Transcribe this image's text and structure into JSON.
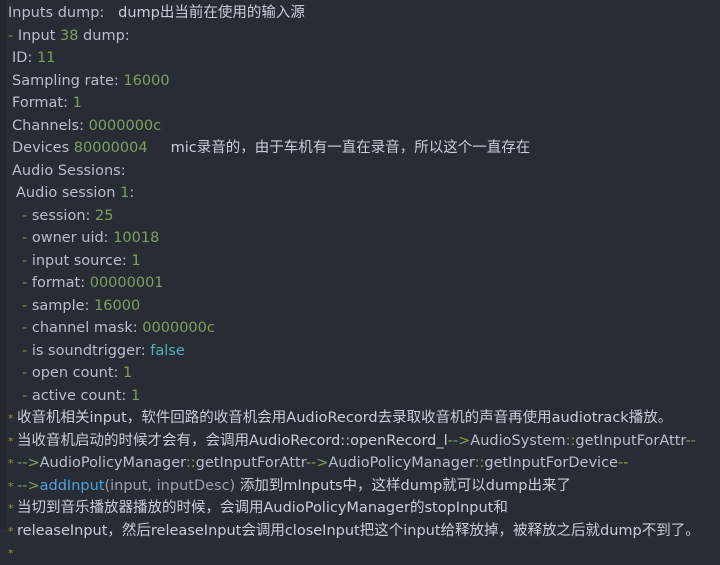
{
  "theme": {
    "background": "#282c34",
    "gutter": "#24272e",
    "text": "#b9bfca",
    "number_green": "#7f9f5f",
    "teal": "#4cb5b5",
    "blue": "#4aa3e0",
    "bullet": "#a08c4a"
  },
  "doc": {
    "title": "Inputs dump",
    "lines": [
      {
        "id": "line-inputs-dump-header",
        "indent": 0,
        "bullet": "",
        "segments": [
          {
            "text": "Inputs dump:",
            "style": "plain"
          },
          {
            "text": "   ",
            "style": "plain"
          },
          {
            "text": "dump出当前在使用的输入源",
            "style": "cjk"
          }
        ]
      },
      {
        "id": "line-input-38-dump",
        "indent": 0,
        "bullet": "",
        "segments": [
          {
            "text": "- ",
            "style": "dash"
          },
          {
            "text": "Input ",
            "style": "plain"
          },
          {
            "text": "38",
            "style": "num"
          },
          {
            "text": " dump:",
            "style": "plain"
          }
        ]
      },
      {
        "id": "line-id",
        "indent": 1,
        "bullet": "",
        "segments": [
          {
            "text": "ID: ",
            "style": "plain"
          },
          {
            "text": "11",
            "style": "num"
          }
        ]
      },
      {
        "id": "line-sampling-rate",
        "indent": 1,
        "bullet": "",
        "segments": [
          {
            "text": "Sampling rate: ",
            "style": "plain"
          },
          {
            "text": "16000",
            "style": "num"
          }
        ]
      },
      {
        "id": "line-format",
        "indent": 1,
        "bullet": "",
        "segments": [
          {
            "text": "Format: ",
            "style": "plain"
          },
          {
            "text": "1",
            "style": "num"
          }
        ]
      },
      {
        "id": "line-channels",
        "indent": 1,
        "bullet": "",
        "segments": [
          {
            "text": "Channels: ",
            "style": "plain"
          },
          {
            "text": "0000000c",
            "style": "num"
          }
        ]
      },
      {
        "id": "line-devices",
        "indent": 1,
        "bullet": "",
        "segments": [
          {
            "text": "Devices ",
            "style": "plain"
          },
          {
            "text": "80000004",
            "style": "num"
          },
          {
            "text": "     ",
            "style": "plain"
          },
          {
            "text": "mic录音的，由于车机有一直在录音，所以这个一直存在",
            "style": "cjk"
          }
        ]
      },
      {
        "id": "line-audio-sessions",
        "indent": 1,
        "bullet": "",
        "segments": [
          {
            "text": "Audio Sessions:",
            "style": "plain"
          }
        ]
      },
      {
        "id": "line-audio-session-1",
        "indent": 2,
        "bullet": "",
        "segments": [
          {
            "text": "Audio session ",
            "style": "plain"
          },
          {
            "text": "1",
            "style": "num"
          },
          {
            "text": ":",
            "style": "plain"
          }
        ]
      },
      {
        "id": "line-session",
        "indent": 3,
        "bullet": "",
        "segments": [
          {
            "text": "- ",
            "style": "dash"
          },
          {
            "text": "session: ",
            "style": "plain"
          },
          {
            "text": "25",
            "style": "num"
          }
        ]
      },
      {
        "id": "line-owner-uid",
        "indent": 3,
        "bullet": "",
        "segments": [
          {
            "text": "- ",
            "style": "dash"
          },
          {
            "text": "owner uid: ",
            "style": "plain"
          },
          {
            "text": "10018",
            "style": "num"
          }
        ]
      },
      {
        "id": "line-input-source",
        "indent": 3,
        "bullet": "",
        "segments": [
          {
            "text": "- ",
            "style": "dash"
          },
          {
            "text": "input source: ",
            "style": "plain"
          },
          {
            "text": "1",
            "style": "num"
          }
        ]
      },
      {
        "id": "line-format-session",
        "indent": 3,
        "bullet": "",
        "segments": [
          {
            "text": "- ",
            "style": "dash"
          },
          {
            "text": "format: ",
            "style": "plain"
          },
          {
            "text": "00000001",
            "style": "num"
          }
        ]
      },
      {
        "id": "line-sample",
        "indent": 3,
        "bullet": "",
        "segments": [
          {
            "text": "- ",
            "style": "dash"
          },
          {
            "text": "sample: ",
            "style": "plain"
          },
          {
            "text": "16000",
            "style": "num"
          }
        ]
      },
      {
        "id": "line-channel-mask",
        "indent": 3,
        "bullet": "",
        "segments": [
          {
            "text": "- ",
            "style": "dash"
          },
          {
            "text": "channel mask: ",
            "style": "plain"
          },
          {
            "text": "0000000c",
            "style": "num"
          }
        ]
      },
      {
        "id": "line-is-soundtrigger",
        "indent": 3,
        "bullet": "",
        "segments": [
          {
            "text": "- ",
            "style": "dash"
          },
          {
            "text": "is soundtrigger: ",
            "style": "plain"
          },
          {
            "text": "false",
            "style": "teal"
          }
        ]
      },
      {
        "id": "line-open-count",
        "indent": 3,
        "bullet": "",
        "segments": [
          {
            "text": "- ",
            "style": "dash"
          },
          {
            "text": "open count: ",
            "style": "plain"
          },
          {
            "text": "1",
            "style": "num"
          }
        ]
      },
      {
        "id": "line-active-count",
        "indent": 3,
        "bullet": "",
        "segments": [
          {
            "text": "- ",
            "style": "dash"
          },
          {
            "text": "active count: ",
            "style": "plain"
          },
          {
            "text": "1",
            "style": "num"
          }
        ]
      },
      {
        "id": "line-note-radio-input",
        "indent": 0,
        "bullet": "*",
        "segments": [
          {
            "text": "收音机相关input，软件回路的收音机会用AudioRecord去录取收音机的声音再使用audiotrack播放。",
            "style": "cjk"
          }
        ]
      },
      {
        "id": "line-note-radio-start",
        "indent": 0,
        "bullet": "*",
        "segments": [
          {
            "text": "当收音机启动的时候才会有，会调用AudioRecord::openRecord_l",
            "style": "cjk"
          },
          {
            "text": "-->",
            "style": "arrow"
          },
          {
            "text": "AudioSystem",
            "style": "plain"
          },
          {
            "text": "::",
            "style": "colons"
          },
          {
            "text": "getInputForAttr",
            "style": "plain"
          },
          {
            "text": "--",
            "style": "arrow"
          }
        ]
      },
      {
        "id": "line-note-apm-getinputforattr",
        "indent": 0,
        "bullet": "*",
        "segments": [
          {
            "text": "-->",
            "style": "arrow"
          },
          {
            "text": "AudioPolicyManager",
            "style": "plain"
          },
          {
            "text": "::",
            "style": "colons"
          },
          {
            "text": "getInputForAttr",
            "style": "plain"
          },
          {
            "text": "-->",
            "style": "arrow"
          },
          {
            "text": "AudioPolicyManager",
            "style": "plain"
          },
          {
            "text": "::",
            "style": "colons"
          },
          {
            "text": "getInputForDevice",
            "style": "plain"
          },
          {
            "text": "--",
            "style": "arrow"
          }
        ]
      },
      {
        "id": "line-note-addinput",
        "indent": 0,
        "bullet": "*",
        "segments": [
          {
            "text": "-->",
            "style": "arrow"
          },
          {
            "text": "addInput",
            "style": "blue"
          },
          {
            "text": "(input, inputDesc)",
            "style": "dim"
          },
          {
            "text": " 添加到mInputs中，这样dump就可以dump出来了",
            "style": "cjk"
          }
        ]
      },
      {
        "id": "line-note-stopinput",
        "indent": 0,
        "bullet": "*",
        "segments": [
          {
            "text": "当切到音乐播放器播放的时候，会调用AudioPolicyManager的stopInput和",
            "style": "cjk"
          }
        ]
      },
      {
        "id": "line-note-releaseinput",
        "indent": 0,
        "bullet": "*",
        "segments": [
          {
            "text": "releaseInput，然后releaseInput会调用closeInput把这个input给释放掉，被释放之后就dump不到了。",
            "style": "cjk"
          }
        ]
      },
      {
        "id": "line-note-empty",
        "indent": 0,
        "bullet": "*",
        "segments": []
      }
    ]
  }
}
